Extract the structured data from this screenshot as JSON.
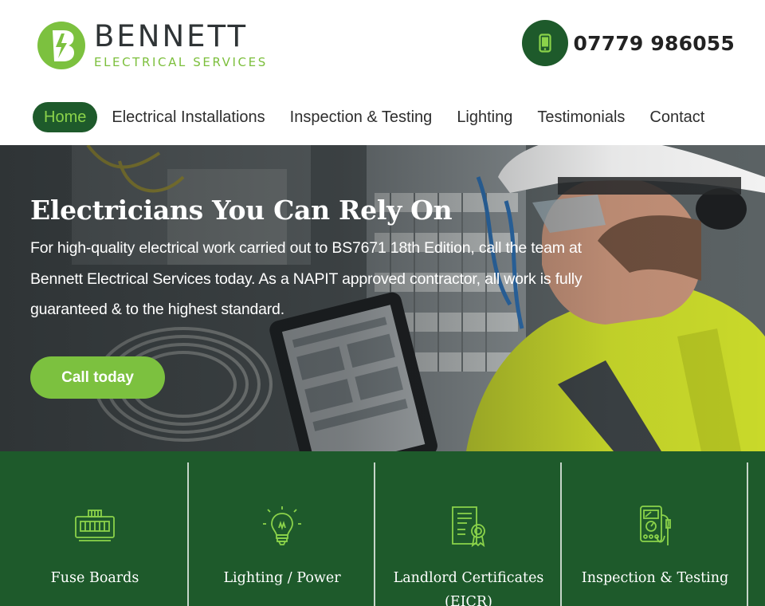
{
  "brand": {
    "name": "BENNETT",
    "subtitle": "ELECTRICAL SERVICES",
    "logo_letter": "B",
    "primary_color": "#1e5a2b",
    "accent_color": "#7cc13f"
  },
  "header": {
    "phone_icon": "mobile-phone-icon",
    "phone_number": "07779 986055"
  },
  "nav": {
    "items": [
      {
        "label": "Home",
        "active": true
      },
      {
        "label": "Electrical Installations",
        "active": false
      },
      {
        "label": "Inspection & Testing",
        "active": false
      },
      {
        "label": "Lighting",
        "active": false
      },
      {
        "label": "Testimonials",
        "active": false
      },
      {
        "label": "Contact",
        "active": false
      }
    ]
  },
  "hero": {
    "title": "Electricians You Can Rely On",
    "text": "For high-quality electrical work carried out to BS7671 18th Edition, call the team at Bennett Electrical Services today. As a NAPIT approved contractor, all work is fully guaranteed & to the highest standard.",
    "cta_label": "Call today"
  },
  "services": [
    {
      "icon": "fuse-board-icon",
      "label": "Fuse Boards"
    },
    {
      "icon": "light-bulb-icon",
      "label": "Lighting / Power"
    },
    {
      "icon": "certificate-icon",
      "label": "Landlord Certificates (EICR)"
    },
    {
      "icon": "multimeter-icon",
      "label": "Inspection & Testing"
    }
  ]
}
